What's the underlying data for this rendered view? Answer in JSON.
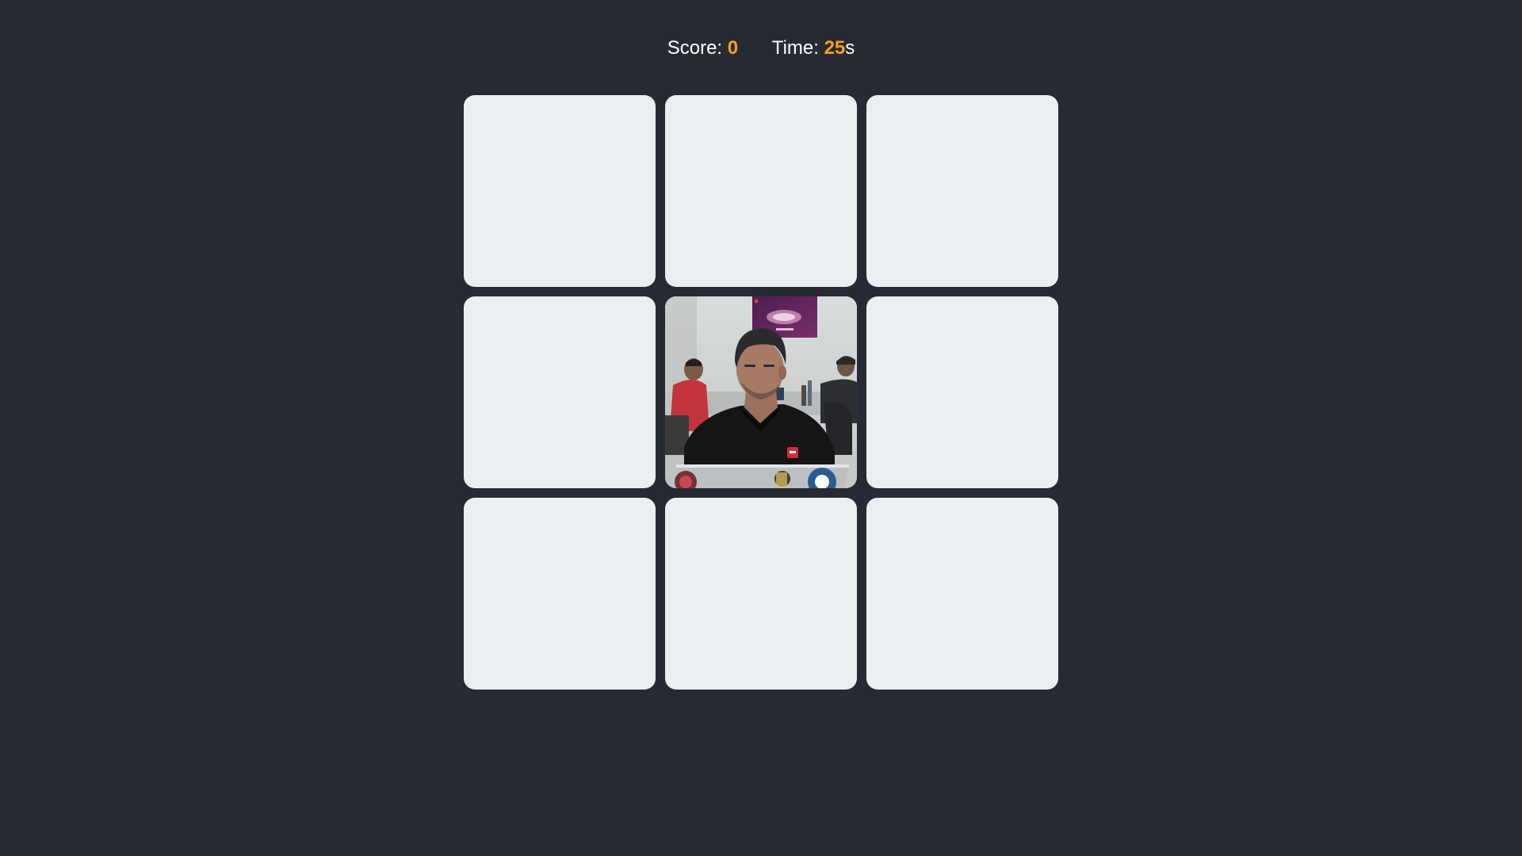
{
  "hud": {
    "score_label": "Score:",
    "score_value": "0",
    "time_label": "Time:",
    "time_value": "25",
    "time_unit": "s"
  },
  "colors": {
    "background": "#262a33",
    "tile": "#ebeff1",
    "accent": "#f5a10f",
    "text": "#ffffff"
  },
  "grid": {
    "rows": 3,
    "cols": 3,
    "tiles": [
      {
        "id": 1,
        "state": "hidden"
      },
      {
        "id": 2,
        "state": "hidden"
      },
      {
        "id": 3,
        "state": "hidden"
      },
      {
        "id": 4,
        "state": "hidden"
      },
      {
        "id": 5,
        "state": "revealed",
        "content": "photo-person-at-laptop"
      },
      {
        "id": 6,
        "state": "hidden"
      },
      {
        "id": 7,
        "state": "hidden"
      },
      {
        "id": 8,
        "state": "hidden"
      },
      {
        "id": 9,
        "state": "hidden"
      }
    ]
  }
}
